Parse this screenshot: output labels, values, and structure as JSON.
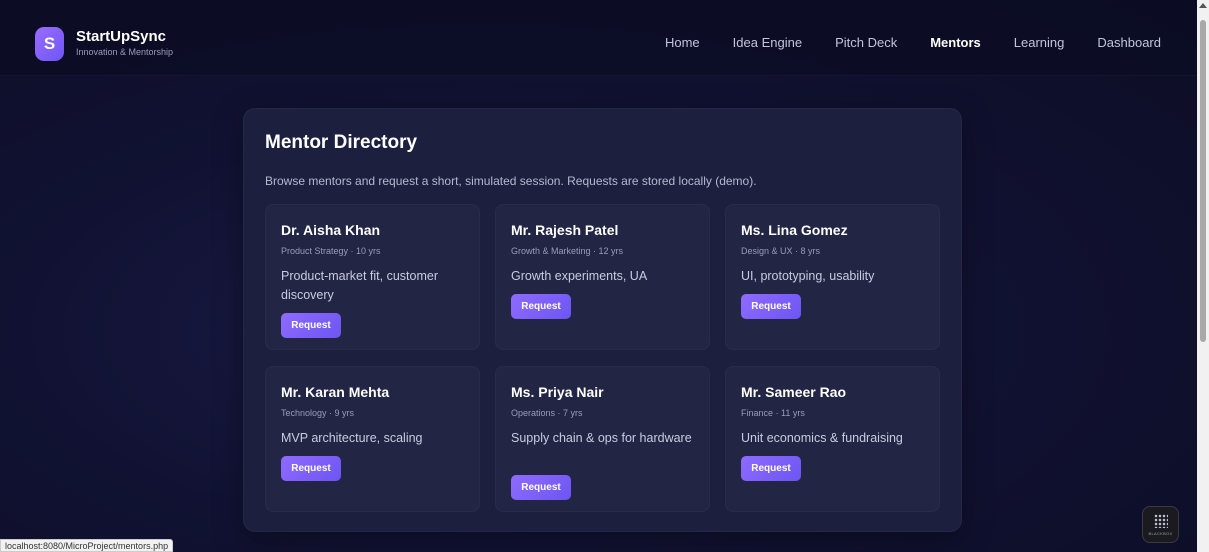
{
  "brand": {
    "logo_letter": "S",
    "name": "StartUpSync",
    "tagline": "Innovation & Mentorship"
  },
  "nav": {
    "items": [
      {
        "label": "Home",
        "active": false
      },
      {
        "label": "Idea Engine",
        "active": false
      },
      {
        "label": "Pitch Deck",
        "active": false
      },
      {
        "label": "Mentors",
        "active": true
      },
      {
        "label": "Learning",
        "active": false
      },
      {
        "label": "Dashboard",
        "active": false
      }
    ]
  },
  "directory": {
    "title": "Mentor Directory",
    "description": "Browse mentors and request a short, simulated session. Requests are stored locally (demo).",
    "mentors": [
      {
        "name": "Dr. Aisha Khan",
        "meta": "Product Strategy · 10 yrs",
        "focus": "Product-market fit, customer discovery",
        "button": "Request"
      },
      {
        "name": "Mr. Rajesh Patel",
        "meta": "Growth & Marketing · 12 yrs",
        "focus": "Growth experiments, UA",
        "button": "Request"
      },
      {
        "name": "Ms. Lina Gomez",
        "meta": "Design & UX · 8 yrs",
        "focus": "UI, prototyping, usability",
        "button": "Request"
      },
      {
        "name": "Mr. Karan Mehta",
        "meta": "Technology · 9 yrs",
        "focus": "MVP architecture, scaling",
        "button": "Request"
      },
      {
        "name": "Ms. Priya Nair",
        "meta": "Operations · 7 yrs",
        "focus": "Supply chain & ops for hardware",
        "button": "Request"
      },
      {
        "name": "Mr. Sameer Rao",
        "meta": "Finance · 11 yrs",
        "focus": "Unit economics & fundraising",
        "button": "Request"
      }
    ]
  },
  "status_bar": {
    "url": "localhost:8080/MicroProject/mentors.php"
  },
  "corner_widget": {
    "label": "BLACKBOX",
    "icon": "dots-grid-icon"
  },
  "colors": {
    "accent": "#7c5cff",
    "background": "#111233",
    "panel": "#1d1f3e",
    "card": "#232545"
  }
}
